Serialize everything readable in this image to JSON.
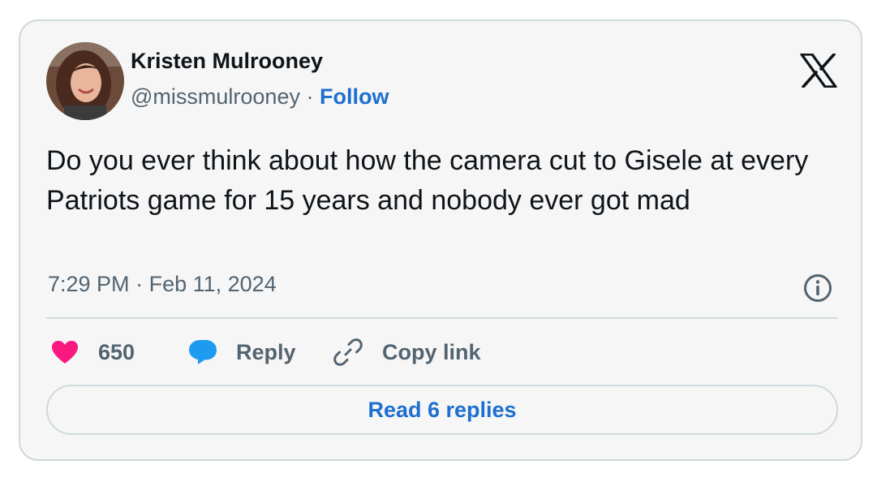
{
  "author": {
    "name": "Kristen Mulrooney",
    "handle": "@missmulrooney",
    "separator": "·",
    "follow_label": "Follow"
  },
  "tweet": {
    "text": "Do you ever think about how the camera cut to Gisele at every Patriots game for 15 years and nobody ever got mad",
    "time": "7:29 PM",
    "date_separator": "·",
    "date": "Feb 11, 2024"
  },
  "actions": {
    "likes": "650",
    "reply_label": "Reply",
    "copy_link_label": "Copy link",
    "read_replies_label": "Read 6 replies"
  },
  "icons": {
    "logo": "x-logo-icon",
    "info": "info-icon",
    "like": "heart-icon",
    "reply": "speech-bubble-icon",
    "copy": "link-icon"
  },
  "colors": {
    "like_pink": "#f91880",
    "reply_blue": "#1d9bf0",
    "link_blue": "#1d6fd0",
    "muted_gray": "#536471",
    "card_background": "#f6f6f6",
    "border": "#cfd9de"
  }
}
